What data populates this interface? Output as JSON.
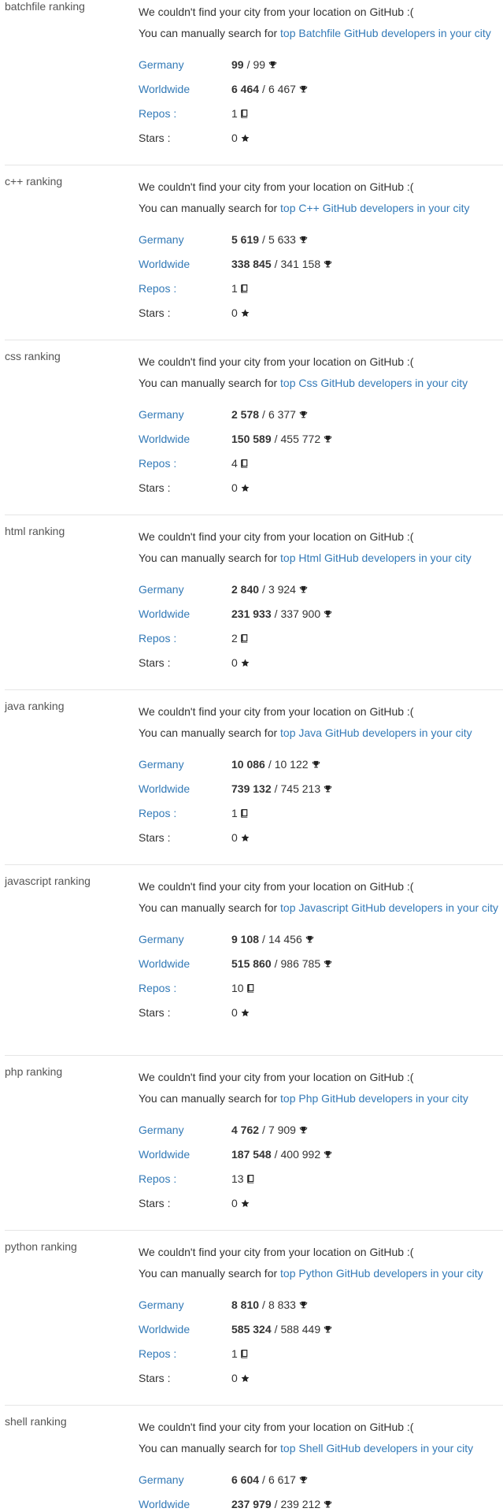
{
  "labels": {
    "not_found": "We couldn't find your city from your location on GitHub :(",
    "manual_search": "You can manually search for ",
    "country": "Germany",
    "worldwide": "Worldwide",
    "repos": "Repos :",
    "stars": "Stars :",
    "separator": "/"
  },
  "icons": {
    "rank": "trophy-icon",
    "repos": "repo-book-icon",
    "stars": "star-icon"
  },
  "colors": {
    "link": "#337ab7",
    "text": "#333333",
    "title": "#555555",
    "separator": "#e5e5e5"
  },
  "rankings": [
    {
      "title": "batchfile ranking",
      "search_link": "top Batchfile GitHub developers in your city",
      "country_rank": "99",
      "country_total": "99",
      "world_rank": "6 464",
      "world_total": "6 467",
      "repos": "1",
      "stars": "0"
    },
    {
      "title": "c++ ranking",
      "search_link": "top C++ GitHub developers in your city",
      "country_rank": "5 619",
      "country_total": "5 633",
      "world_rank": "338 845",
      "world_total": "341 158",
      "repos": "1",
      "stars": "0"
    },
    {
      "title": "css ranking",
      "search_link": "top Css GitHub developers in your city",
      "country_rank": "2 578",
      "country_total": "6 377",
      "world_rank": "150 589",
      "world_total": "455 772",
      "repos": "4",
      "stars": "0"
    },
    {
      "title": "html ranking",
      "search_link": "top Html GitHub developers in your city",
      "country_rank": "2 840",
      "country_total": "3 924",
      "world_rank": "231 933",
      "world_total": "337 900",
      "repos": "2",
      "stars": "0"
    },
    {
      "title": "java ranking",
      "search_link": "top Java GitHub developers in your city",
      "country_rank": "10 086",
      "country_total": "10 122",
      "world_rank": "739 132",
      "world_total": "745 213",
      "repos": "1",
      "stars": "0"
    },
    {
      "title": "javascript ranking",
      "search_link": "top Javascript GitHub developers in your city",
      "country_rank": "9 108",
      "country_total": "14 456",
      "world_rank": "515 860",
      "world_total": "986 785",
      "repos": "10",
      "stars": "0"
    },
    {
      "title": "php ranking",
      "search_link": "top Php GitHub developers in your city",
      "country_rank": "4 762",
      "country_total": "7 909",
      "world_rank": "187 548",
      "world_total": "400 992",
      "repos": "13",
      "stars": "0"
    },
    {
      "title": "python ranking",
      "search_link": "top Python GitHub developers in your city",
      "country_rank": "8 810",
      "country_total": "8 833",
      "world_rank": "585 324",
      "world_total": "588 449",
      "repos": "1",
      "stars": "0"
    },
    {
      "title": "shell ranking",
      "search_link": "top Shell GitHub developers in your city",
      "country_rank": "6 604",
      "country_total": "6 617",
      "world_rank": "237 979",
      "world_total": "239 212",
      "repos": null,
      "stars": null
    }
  ]
}
